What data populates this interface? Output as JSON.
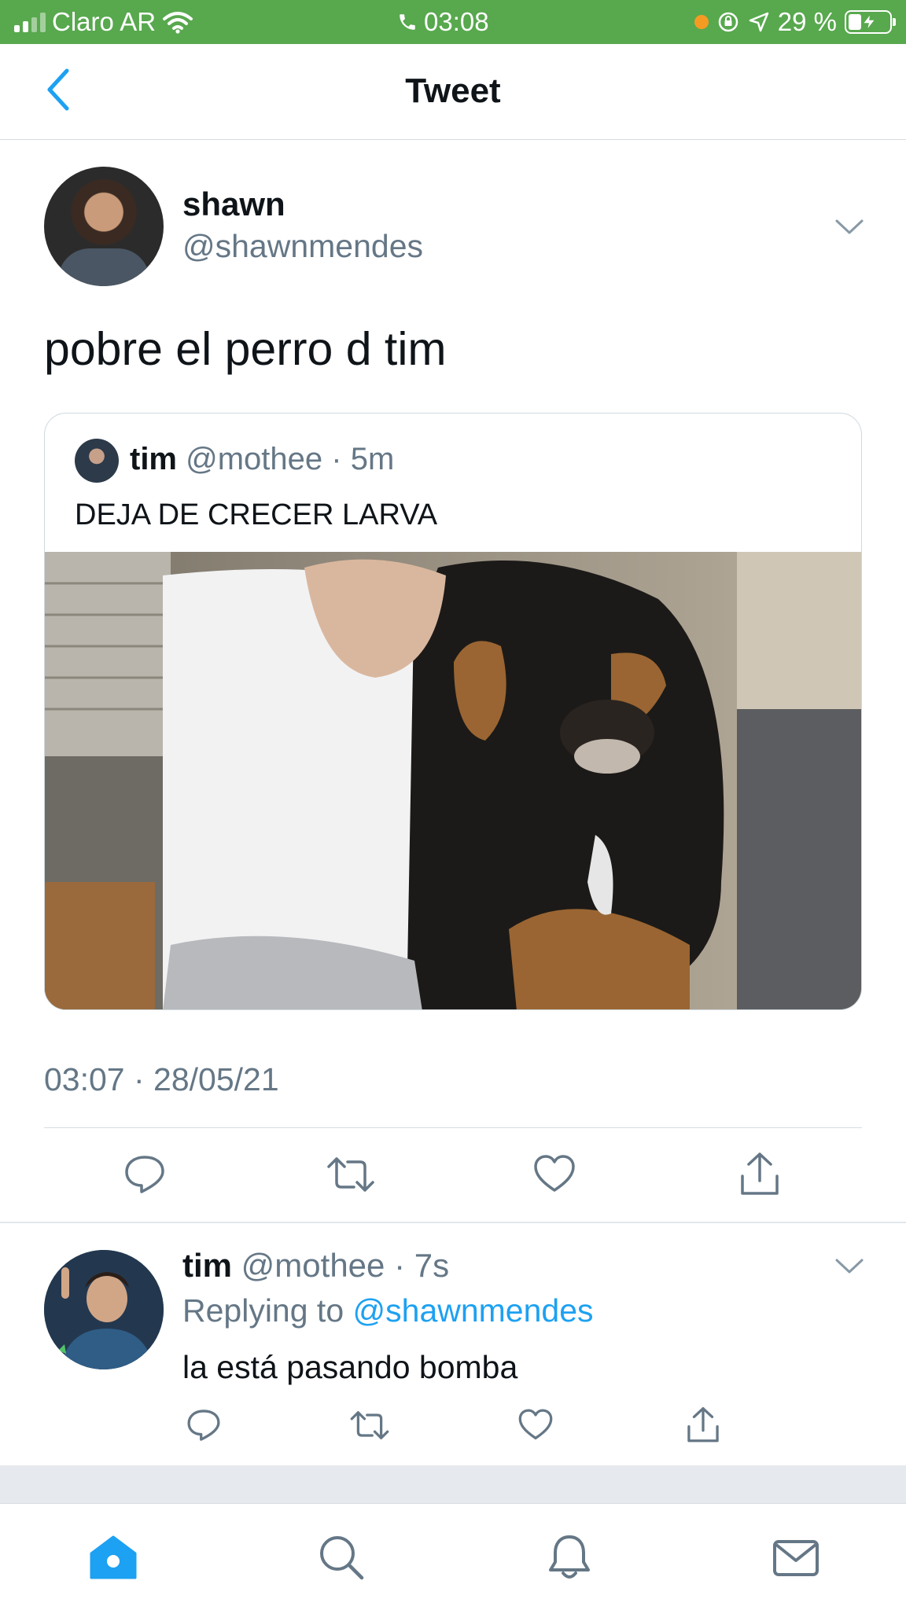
{
  "status_bar": {
    "carrier": "Claro AR",
    "time": "03:08",
    "battery_text": "29 %",
    "battery_level": 0.29,
    "background_color": "#58a84e"
  },
  "nav": {
    "title": "Tweet",
    "back_icon": "chevron-left-icon",
    "accent_color": "#1da1f2"
  },
  "tweet": {
    "author_name": "shawn",
    "author_handle": "@shawnmendes",
    "text": "pobre el perro d tim",
    "timestamp": "03:07 · 28/05/21",
    "quoted": {
      "name": "tim",
      "meta": "@mothee · 5m",
      "text": "DEJA DE CRECER LARVA",
      "media": "photo of a baby in a white shirt standing next to a large rottweiler dog"
    },
    "actions": [
      "reply-icon",
      "retweet-icon",
      "like-icon",
      "share-icon"
    ]
  },
  "reply": {
    "name": "tim",
    "meta": "@mothee · 7s",
    "replying_prefix": "Replying to ",
    "replying_handle": "@shawnmendes",
    "text": "la está pasando bomba",
    "actions": [
      "reply-icon",
      "retweet-icon",
      "like-icon",
      "share-icon"
    ]
  },
  "tab_bar": {
    "tabs": [
      "home-icon",
      "search-icon",
      "notifications-icon",
      "messages-icon"
    ],
    "active": "home-icon"
  }
}
